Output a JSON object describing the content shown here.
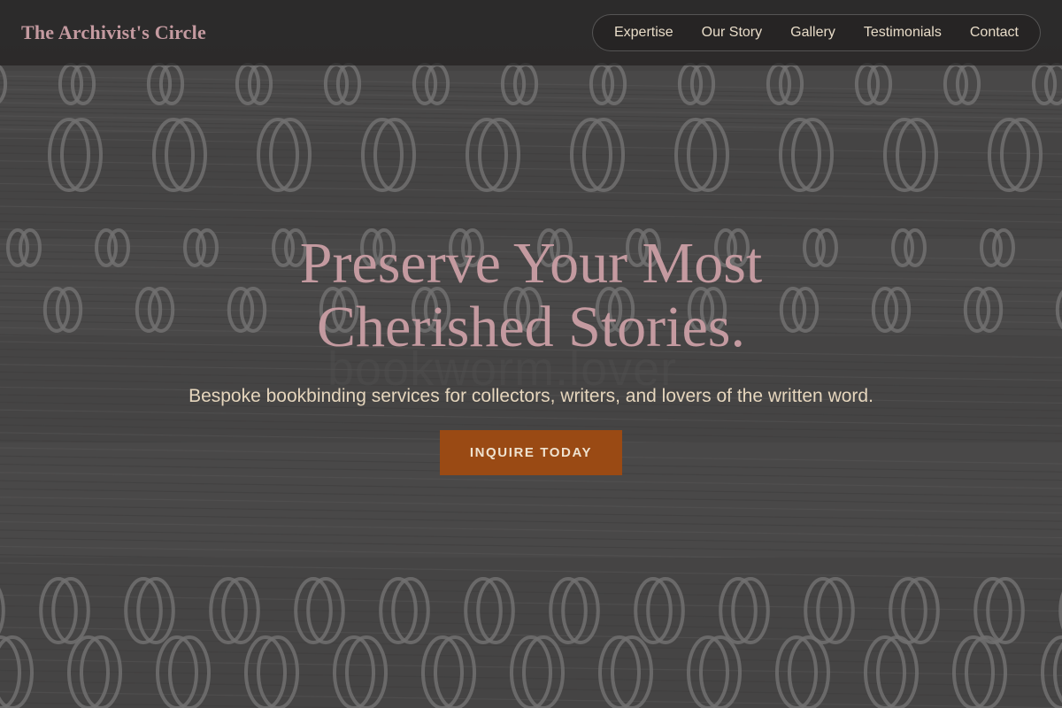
{
  "header": {
    "brand": "The Archivist's Circle",
    "nav": [
      {
        "label": "Expertise"
      },
      {
        "label": "Our Story"
      },
      {
        "label": "Gallery"
      },
      {
        "label": "Testimonials"
      },
      {
        "label": "Contact"
      }
    ]
  },
  "hero": {
    "title": "Preserve Your Most Cherished Stories.",
    "subtitle": "Bespoke bookbinding services for collectors, writers, and lovers of the written word.",
    "cta_label": "INQUIRE TODAY",
    "watermark": "bookworm.lover"
  },
  "colors": {
    "brand": "#c49aa0",
    "nav_text": "#e8dcc8",
    "cta_bg": "#9a4a14",
    "subtitle": "#e6d6bd"
  }
}
